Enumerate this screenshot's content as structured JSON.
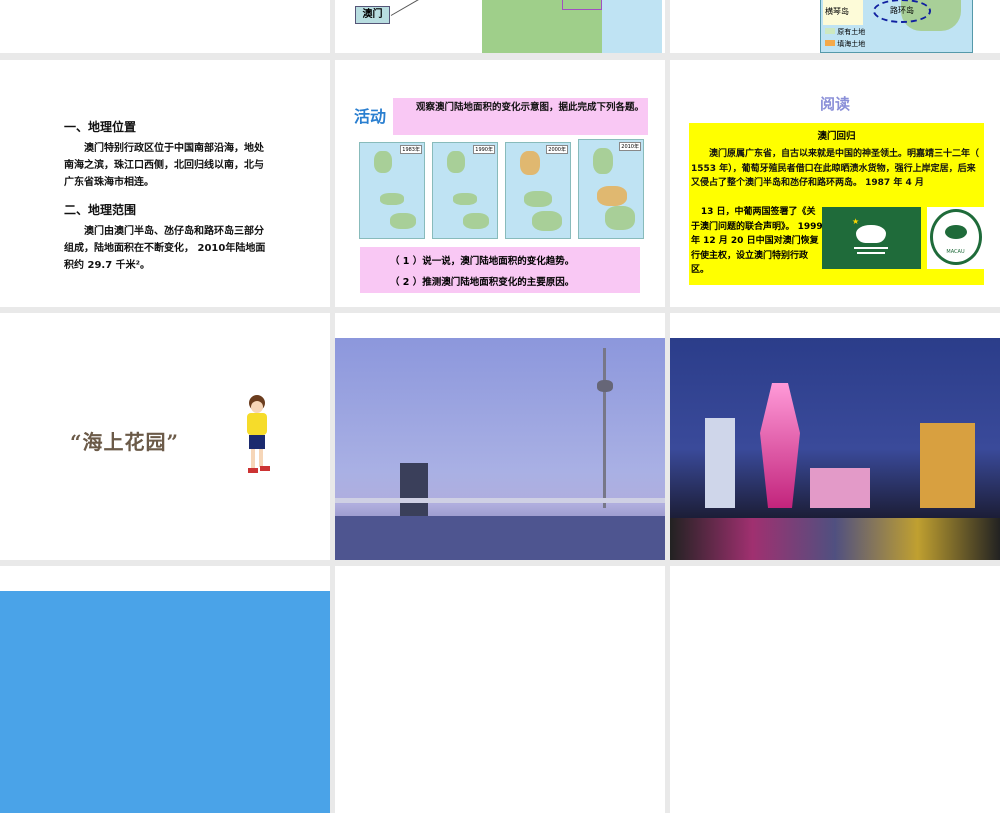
{
  "slide_top_row": {
    "macau_label": "澳门",
    "legend": [
      "原有土地",
      "填海土地"
    ],
    "hengqin": "横琴岛",
    "coloane": "路环岛"
  },
  "slide_geography": {
    "heading1": "一、地理位置",
    "para1": "澳门特别行政区位于中国南部沿海，地处南海之滨，珠江口西侧，北回归线以南，北与广东省珠海市相连。",
    "heading2": "二、地理范围",
    "para2": "澳门由澳门半岛、氹仔岛和路环岛三部分组成，陆地面积在不断变化， 2010年陆地面积约 29.7 千米²。"
  },
  "slide_activity": {
    "title": "活动",
    "prompt": "观察澳门陆地面积的变化示意图，据此完成下列各题。",
    "maps": [
      "1983年",
      "1990年",
      "2000年",
      "2010年"
    ],
    "q1": "（ 1 ）说一说，澳门陆地面积的变化趋势。",
    "q2": "（ 2 ）推测澳门陆地面积变化的主要原因。"
  },
  "slide_reading": {
    "title": "阅读",
    "box_title": "澳门回归",
    "text_top": "澳门原属广东省，自古以来就是中国的神圣领土。明嘉靖三十二年（ 1553 年），葡萄牙殖民者借口在此晾晒渍水货物，强行上岸定居，后来又侵占了整个澳门半岛和氹仔和路环两岛。 1987 年 4 月",
    "text_side": "13 日，中葡两国签署了《关于澳门问题的联合声明》。 1999 年 12 月 20 日中国对澳门恢复行使主权，设立澳门特别行政区。",
    "emblem_text": "MACAU"
  },
  "slide_garden": {
    "title": "“海上花园”"
  },
  "colors": {
    "pink": "#f9c8f4",
    "yellow": "#ffff00",
    "flag_green": "#1f6b3a",
    "reading_title": "#8a8fd8",
    "activity_title": "#2a7fd0"
  }
}
